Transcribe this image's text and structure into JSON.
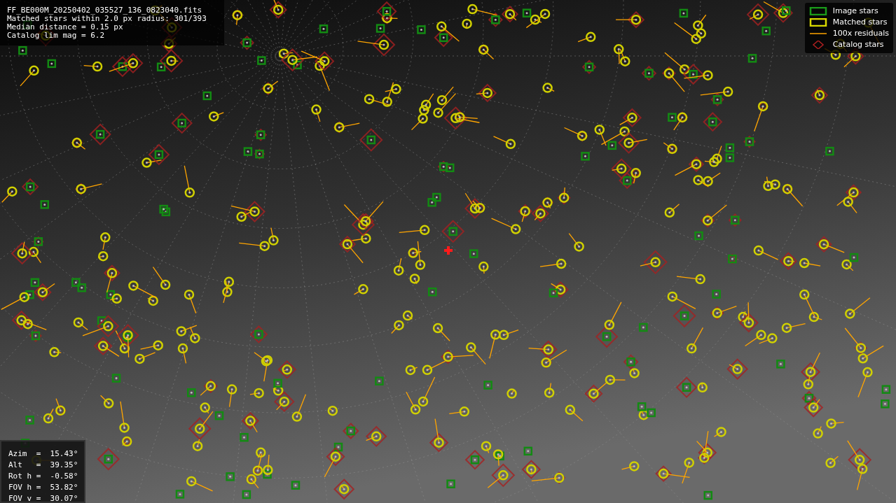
{
  "header_lines": [
    "FF_BE000M_20250402_035527_136_0823040.fits",
    "Matched stars within 2.0 px radius: 301/393",
    "Median distance = 0.15 px",
    "Catalog lim mag = 6.2"
  ],
  "legend": [
    {
      "kind": "image",
      "label": "Image stars"
    },
    {
      "kind": "matched",
      "label": "Matched stars"
    },
    {
      "kind": "residual",
      "label": "100x residuals"
    },
    {
      "kind": "catalog",
      "label": "Catalog stars"
    }
  ],
  "pointing": [
    "Azim  =  15.43°",
    "Alt   =  39.35°",
    "Rot h =  -0.58°",
    "FOV h =  53.82°",
    "FOV v =  30.07°"
  ]
}
